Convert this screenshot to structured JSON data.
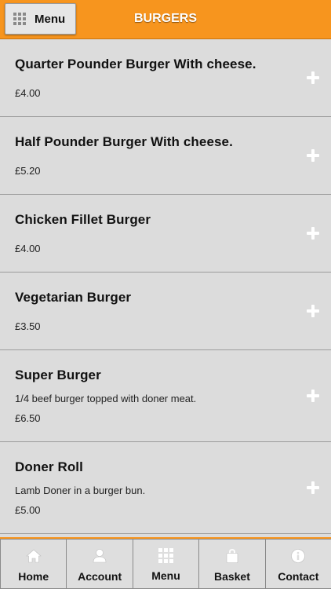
{
  "header": {
    "menu_button_label": "Menu",
    "title": "BURGERS",
    "background_color": "#f7951e"
  },
  "items": [
    {
      "name": "Quarter Pounder Burger With cheese.",
      "description": "",
      "price": "£4.00"
    },
    {
      "name": "Half Pounder Burger With cheese.",
      "description": "",
      "price": "£5.20"
    },
    {
      "name": "Chicken Fillet Burger",
      "description": "",
      "price": "£4.00"
    },
    {
      "name": "Vegetarian Burger",
      "description": "",
      "price": "£3.50"
    },
    {
      "name": "Super Burger",
      "description": "1/4 beef burger topped with doner meat.",
      "price": "£6.50"
    },
    {
      "name": "Doner Roll",
      "description": "Lamb Doner in a burger bun.",
      "price": "£5.00"
    }
  ],
  "bottom_nav": [
    {
      "label": "Home",
      "icon": "home-icon"
    },
    {
      "label": "Account",
      "icon": "user-icon"
    },
    {
      "label": "Menu",
      "icon": "grid-icon"
    },
    {
      "label": "Basket",
      "icon": "basket-icon"
    },
    {
      "label": "Contact",
      "icon": "info-icon"
    }
  ]
}
